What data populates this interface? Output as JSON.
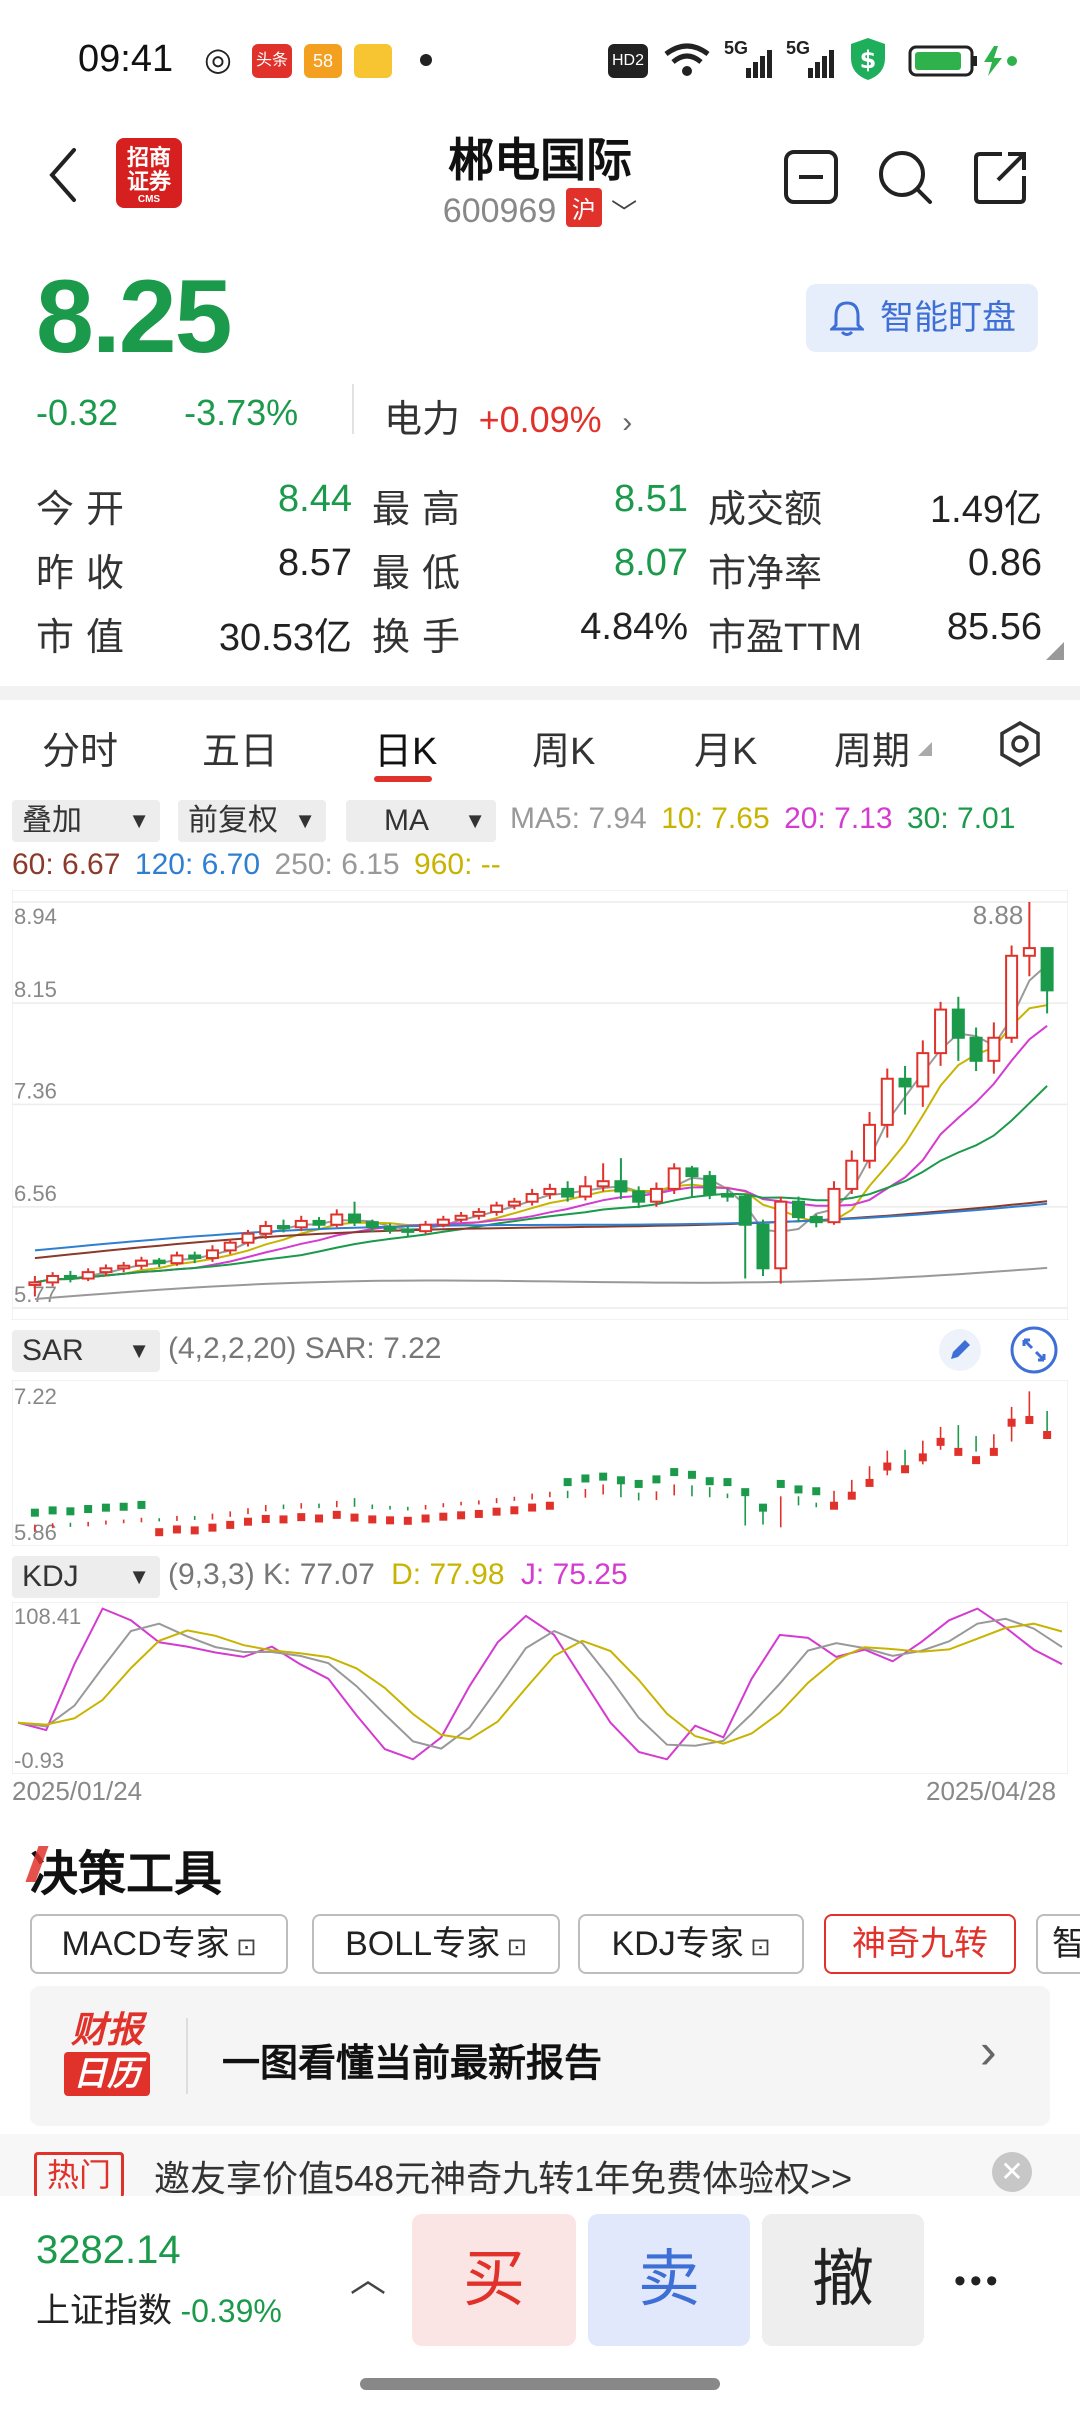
{
  "status_bar": {
    "time": "09:41",
    "news_badge": "头条",
    "app58_badge": "58",
    "signal_5g_1": "5G",
    "signal_5g_2": "5G",
    "hd_badge": "HD2"
  },
  "header": {
    "stock_name": "郴电国际",
    "stock_code": "600969",
    "market": "沪",
    "logo_text_line1": "招商",
    "logo_text_line2": "证券",
    "logo_text_line3": "CMS"
  },
  "quote": {
    "price": "8.25",
    "change": "-0.32",
    "change_pct": "-3.73%",
    "sector_name": "电力",
    "sector_change": "+0.09%",
    "watch_label": "智能盯盘"
  },
  "stats": [
    {
      "label": "今开",
      "value": "8.44",
      "color": "#1b9a4b"
    },
    {
      "label": "最高",
      "value": "8.51",
      "color": "#1b9a4b"
    },
    {
      "label": "成交额",
      "value": "1.49亿",
      "color": "#222222"
    },
    {
      "label": "昨收",
      "value": "8.57",
      "color": "#222222"
    },
    {
      "label": "最低",
      "value": "8.07",
      "color": "#1b9a4b"
    },
    {
      "label": "市净率",
      "value": "0.86",
      "color": "#222222"
    },
    {
      "label": "市值",
      "value": "30.53亿",
      "color": "#222222"
    },
    {
      "label": "换手",
      "value": "4.84%",
      "color": "#222222"
    },
    {
      "label": "市盈TTM",
      "value": "85.56",
      "color": "#222222"
    }
  ],
  "tabs": [
    "分时",
    "五日",
    "日K",
    "周K",
    "月K",
    "周期"
  ],
  "selectors": {
    "overlay": "叠加",
    "adjust": "前复权",
    "indicator": "MA"
  },
  "ma": {
    "ma5": "MA5: 7.94",
    "ma10": "10: 7.65",
    "ma20": "20: 7.13",
    "ma30": "30: 7.01",
    "ma60": "60: 6.67",
    "ma120": "120: 6.70",
    "ma250": "250: 6.15",
    "ma960": "960: --"
  },
  "sar": {
    "selector": "SAR",
    "params": "(4,2,2,20) SAR: 7.22",
    "ymax": "7.22",
    "ymin": "5.86"
  },
  "kdj": {
    "selector": "KDJ",
    "params": "(9,3,3) K: 77.07",
    "d": "D: 77.98",
    "j": "J: 75.25",
    "ymax": "108.41",
    "ymin": "-0.93"
  },
  "dates": {
    "start": "2025/01/24",
    "end": "2025/04/28"
  },
  "chart_data": {
    "type": "candlestick",
    "y_ticks": [
      "8.94",
      "8.15",
      "7.36",
      "6.56",
      "5.77"
    ],
    "ylim": [
      5.77,
      8.94
    ],
    "high_label": "8.88",
    "colors": {
      "up": "#e0322b",
      "down": "#1b9a4b",
      "ma5": "#9a9a9a",
      "ma10": "#c8b400",
      "ma20": "#d43bd0",
      "ma30": "#1b9a4b",
      "ma60": "#8b3a2a",
      "ma120": "#2f7fd1",
      "ma250": "#999999"
    },
    "candles": [
      [
        5.95,
        5.97,
        5.86,
        6.02
      ],
      [
        5.97,
        6.02,
        5.94,
        6.05
      ],
      [
        6.02,
        6.0,
        5.97,
        6.06
      ],
      [
        6.0,
        6.05,
        5.98,
        6.08
      ],
      [
        6.05,
        6.08,
        6.02,
        6.11
      ],
      [
        6.08,
        6.1,
        6.05,
        6.13
      ],
      [
        6.1,
        6.14,
        6.07,
        6.17
      ],
      [
        6.14,
        6.12,
        6.09,
        6.16
      ],
      [
        6.12,
        6.18,
        6.1,
        6.21
      ],
      [
        6.18,
        6.16,
        6.12,
        6.21
      ],
      [
        6.16,
        6.22,
        6.13,
        6.26
      ],
      [
        6.22,
        6.28,
        6.19,
        6.31
      ],
      [
        6.28,
        6.35,
        6.25,
        6.38
      ],
      [
        6.35,
        6.41,
        6.31,
        6.45
      ],
      [
        6.41,
        6.4,
        6.36,
        6.46
      ],
      [
        6.4,
        6.45,
        6.37,
        6.49
      ],
      [
        6.45,
        6.42,
        6.38,
        6.48
      ],
      [
        6.42,
        6.5,
        6.4,
        6.54
      ],
      [
        6.5,
        6.44,
        6.41,
        6.6
      ],
      [
        6.44,
        6.4,
        6.36,
        6.46
      ],
      [
        6.4,
        6.38,
        6.35,
        6.43
      ],
      [
        6.38,
        6.37,
        6.33,
        6.41
      ],
      [
        6.37,
        6.42,
        6.35,
        6.45
      ],
      [
        6.42,
        6.46,
        6.4,
        6.49
      ],
      [
        6.46,
        6.49,
        6.44,
        6.52
      ],
      [
        6.49,
        6.52,
        6.46,
        6.55
      ],
      [
        6.52,
        6.57,
        6.49,
        6.6
      ],
      [
        6.57,
        6.6,
        6.54,
        6.63
      ],
      [
        6.6,
        6.66,
        6.57,
        6.7
      ],
      [
        6.66,
        6.7,
        6.62,
        6.74
      ],
      [
        6.7,
        6.64,
        6.6,
        6.76
      ],
      [
        6.64,
        6.72,
        6.61,
        6.8
      ],
      [
        6.72,
        6.76,
        6.68,
        6.9
      ],
      [
        6.76,
        6.68,
        6.62,
        6.94
      ],
      [
        6.68,
        6.6,
        6.55,
        6.72
      ],
      [
        6.6,
        6.7,
        6.56,
        6.75
      ],
      [
        6.7,
        6.86,
        6.66,
        6.9
      ],
      [
        6.86,
        6.8,
        6.64,
        6.88
      ],
      [
        6.8,
        6.66,
        6.62,
        6.84
      ],
      [
        6.66,
        6.64,
        6.6,
        6.7
      ],
      [
        6.64,
        6.42,
        6.0,
        6.66
      ],
      [
        6.42,
        6.08,
        6.02,
        6.46
      ],
      [
        6.08,
        6.6,
        5.96,
        6.64
      ],
      [
        6.6,
        6.48,
        6.44,
        6.64
      ],
      [
        6.48,
        6.44,
        6.4,
        6.5
      ],
      [
        6.44,
        6.7,
        6.42,
        6.76
      ],
      [
        6.7,
        6.92,
        6.66,
        7.0
      ],
      [
        6.92,
        7.2,
        6.86,
        7.3
      ],
      [
        7.2,
        7.56,
        7.1,
        7.64
      ],
      [
        7.56,
        7.5,
        7.28,
        7.66
      ],
      [
        7.5,
        7.76,
        7.34,
        7.86
      ],
      [
        7.76,
        8.1,
        7.66,
        8.16
      ],
      [
        8.1,
        7.88,
        7.7,
        8.2
      ],
      [
        7.88,
        7.7,
        7.62,
        7.96
      ],
      [
        7.7,
        7.88,
        7.6,
        8.0
      ],
      [
        7.88,
        8.52,
        7.84,
        8.6
      ],
      [
        8.52,
        8.58,
        8.36,
        8.94
      ],
      [
        8.58,
        8.25,
        8.07,
        8.51
      ]
    ]
  },
  "tools": {
    "title": "决策工具",
    "chips": [
      "MACD专家",
      "BOLL专家",
      "KDJ专家",
      "神奇九转",
      "智"
    ],
    "report_logo_1": "财报",
    "report_logo_2": "日历",
    "report_text": "一图看懂当前最新报告",
    "hot_tag": "热门",
    "hot_text": "邀友享价值548元神奇九转1年免费体验权>>"
  },
  "bottom": {
    "index_value": "3282.14",
    "index_name": "上证指数",
    "index_change": "-0.39%",
    "buy": "买",
    "sell": "卖",
    "cancel": "撤",
    "more": "•••"
  }
}
